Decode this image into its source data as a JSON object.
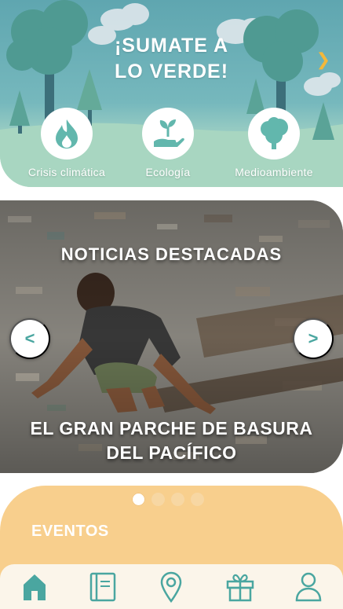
{
  "hero": {
    "title_line1": "¡SUMATE A",
    "title_line2": "LO VERDE!",
    "next_icon": "chevron-right-icon",
    "categories": [
      {
        "label": "Crisis climática",
        "icon": "flame-icon"
      },
      {
        "label": "Ecología",
        "icon": "plant-in-hand-icon"
      },
      {
        "label": "Medioambiente",
        "icon": "tree-icon"
      }
    ]
  },
  "news": {
    "heading": "NOTICIAS DESTACADAS",
    "title_line1": "EL GRAN PARCHE DE BASURA",
    "title_line2": "DEL PACÍFICO",
    "prev_label": "<",
    "next_label": ">"
  },
  "carousel": {
    "pages": 4,
    "active": 1
  },
  "events": {
    "title": "EVENTOS"
  },
  "bottom_nav": [
    {
      "icon": "home-icon",
      "active": true
    },
    {
      "icon": "book-icon"
    },
    {
      "icon": "location-pin-icon"
    },
    {
      "icon": "gift-icon"
    },
    {
      "icon": "user-icon"
    }
  ],
  "colors": {
    "teal": "#4aa6a0",
    "hero_blue": "#5fa6b0",
    "events_orange": "#f8cf8d",
    "accent_yellow": "#f4b83a"
  }
}
